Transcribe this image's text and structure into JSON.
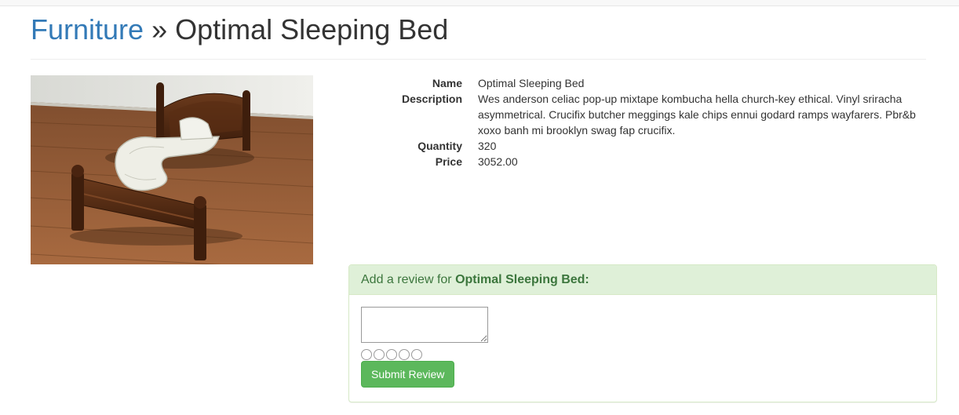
{
  "breadcrumb": {
    "category": "Furniture",
    "separator": " » ",
    "product": "Optimal Sleeping Bed"
  },
  "product_image": {
    "icon": "product-photo",
    "alt": "Optimal Sleeping Bed"
  },
  "details": {
    "name_label": "Name",
    "name_value": "Optimal Sleeping Bed",
    "description_label": "Description",
    "description_value": "Wes anderson celiac pop-up mixtape kombucha hella church-key ethical. Vinyl sriracha asymmetrical. Crucifix butcher meggings kale chips ennui godard ramps wayfarers. Pbr&b xoxo banh mi brooklyn swag fap crucifix.",
    "quantity_label": "Quantity",
    "quantity_value": "320",
    "price_label": "Price",
    "price_value": "3052.00"
  },
  "review": {
    "heading_prefix": "Add a review for ",
    "heading_product": "Optimal Sleeping Bed:",
    "textarea_value": "",
    "rating_options": 5,
    "submit_label": "Submit Review"
  },
  "colors": {
    "link": "#337ab7",
    "panel_heading_bg": "#dff0d8",
    "panel_heading_text": "#3c763d",
    "panel_border": "#d6e9c6",
    "button_bg": "#5cb85c"
  }
}
